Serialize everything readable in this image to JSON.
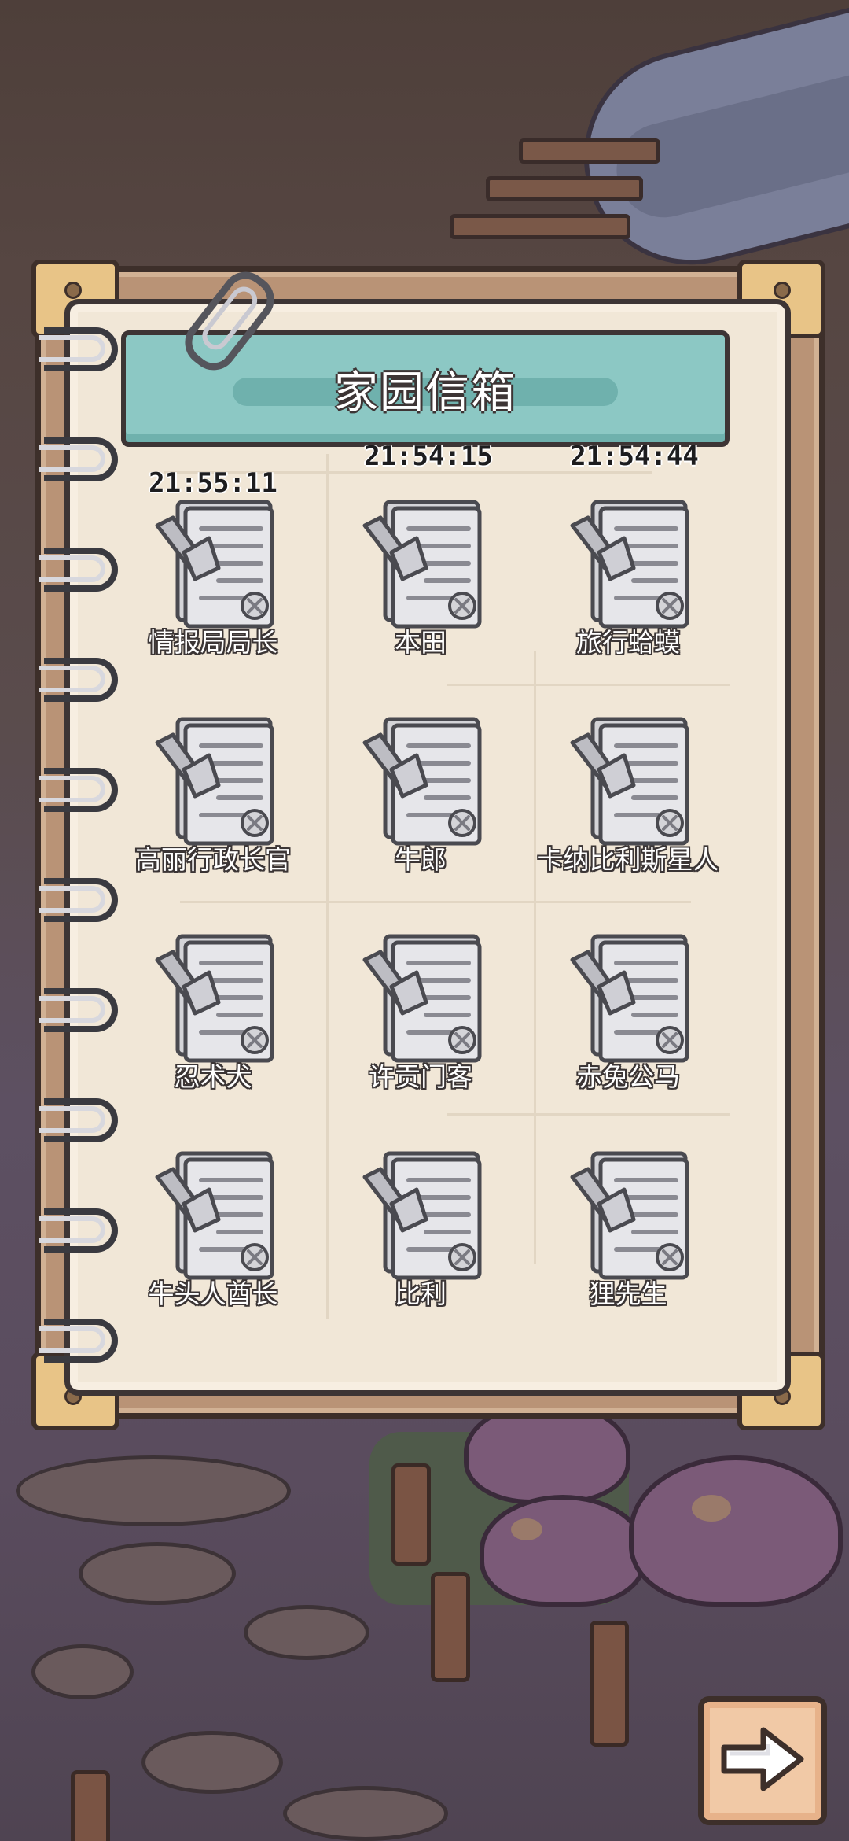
{
  "title": "家园信箱",
  "top_row_timers": [
    "21:54:15",
    "21:54:44"
  ],
  "mail_items": [
    {
      "name": "情报局局长",
      "timer": "21:55:11"
    },
    {
      "name": "本田",
      "timer": ""
    },
    {
      "name": "旅行蛤蟆",
      "timer": ""
    },
    {
      "name": "高丽行政长官",
      "timer": ""
    },
    {
      "name": "牛郎",
      "timer": ""
    },
    {
      "name": "卡纳比利斯星人",
      "timer": ""
    },
    {
      "name": "忍术犬",
      "timer": ""
    },
    {
      "name": "许贡门客",
      "timer": ""
    },
    {
      "name": "赤兔公马",
      "timer": ""
    },
    {
      "name": "牛头人酋长",
      "timer": ""
    },
    {
      "name": "比利",
      "timer": ""
    },
    {
      "name": "狸先生",
      "timer": ""
    }
  ],
  "icons": {
    "letter": "letter-scroll-icon",
    "next": "arrow-right-icon",
    "clip": "paperclip-icon"
  },
  "colors": {
    "banner": "#8cc8c4",
    "paper": "#f1e7d7",
    "frame": "#b99376",
    "button": "#f1c9a6"
  }
}
